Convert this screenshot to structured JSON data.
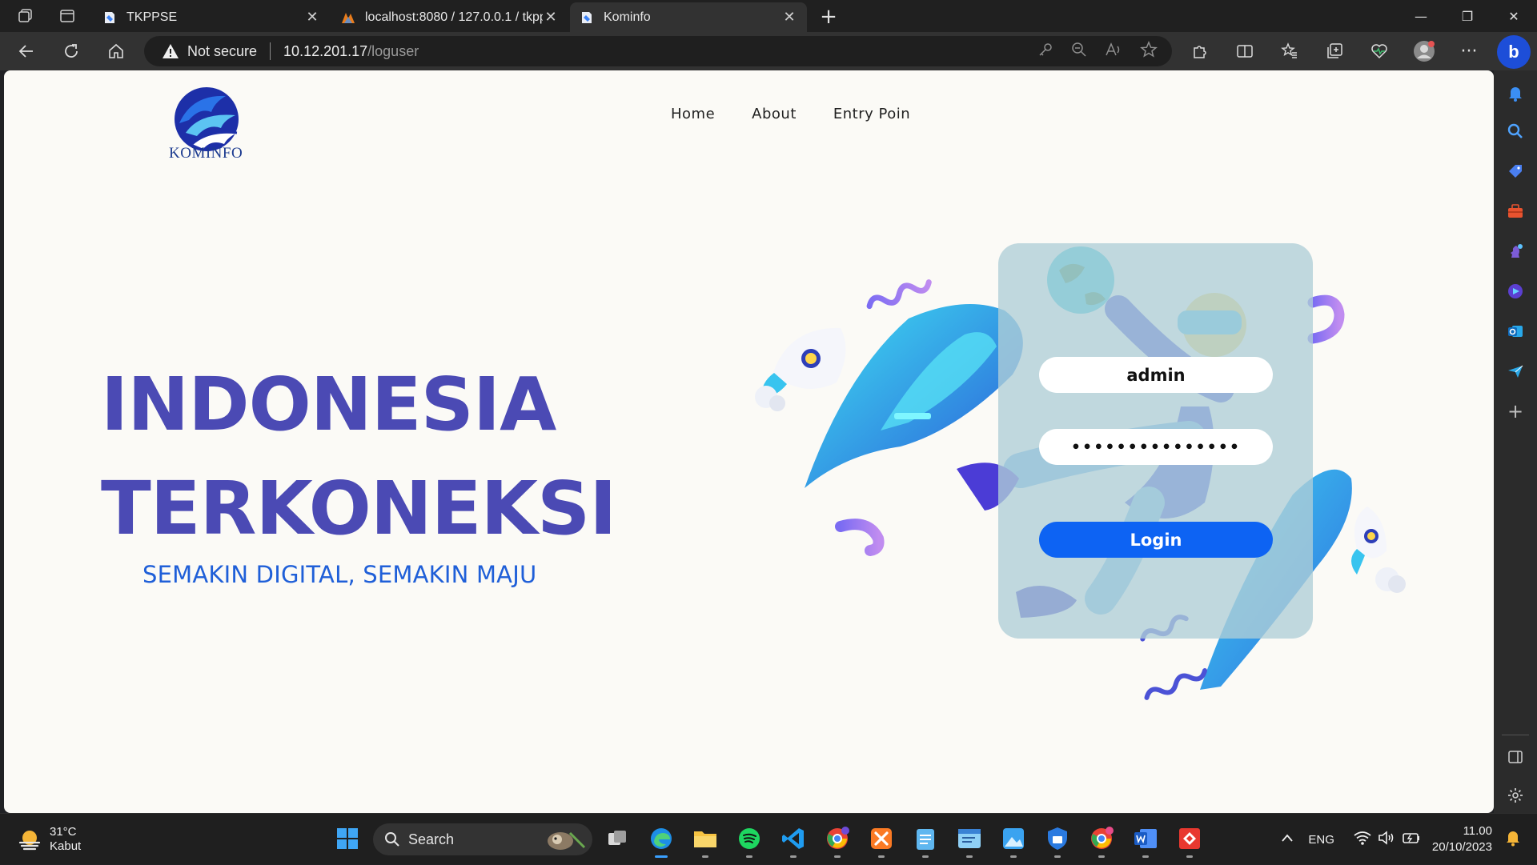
{
  "browser": {
    "tabs": [
      {
        "label": "TKPPSE",
        "active": false
      },
      {
        "label": "localhost:8080 / 127.0.0.1 / tkppse",
        "active": false
      },
      {
        "label": "Kominfo",
        "active": true
      }
    ],
    "security_label": "Not secure",
    "url_host": "10.12.201.17",
    "url_path": "/loguser"
  },
  "site": {
    "logo_text": "KOMINFO",
    "nav": [
      "Home",
      "About",
      "Entry Poin"
    ],
    "hero_line1": "INDONESIA",
    "hero_line2": "TERKONEKSI",
    "tagline": "SEMAKIN DIGITAL, SEMAKIN MAJU"
  },
  "login": {
    "username_value": "admin",
    "password_value": "•••••••••••••••",
    "submit_label": "Login"
  },
  "taskbar": {
    "weather_temp": "31°C",
    "weather_desc": "Kabut",
    "search_label": "Search",
    "language": "ENG",
    "time": "11.00",
    "date": "20/10/2023"
  },
  "colors": {
    "hero": "#4b4ab4",
    "tagline": "#1f5fd8",
    "login_button": "#0d63f3",
    "card": "#b0ced7"
  }
}
